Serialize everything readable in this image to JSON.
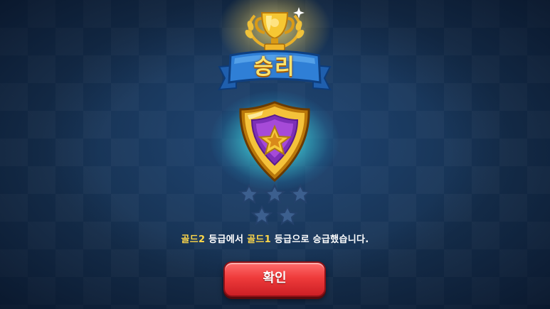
{
  "result": {
    "title": "승리"
  },
  "rank": {
    "stars_total": 5,
    "stars_filled": 0
  },
  "message": {
    "from_tier": "골드2",
    "part1": " 등급에서 ",
    "to_tier": "골드1",
    "part2": " 등급으로 승급했습니다."
  },
  "buttons": {
    "confirm_label": "확인"
  },
  "icons": {
    "trophy": "trophy-icon",
    "shield": "gold-shield-star-icon",
    "star": "star-icon"
  },
  "colors": {
    "title": "#ffe36a",
    "tier_highlight": "#ffd84a",
    "confirm_button": "#ef3b3b",
    "banner": "#2f7fd6",
    "star_empty": "#3c5f8e"
  }
}
